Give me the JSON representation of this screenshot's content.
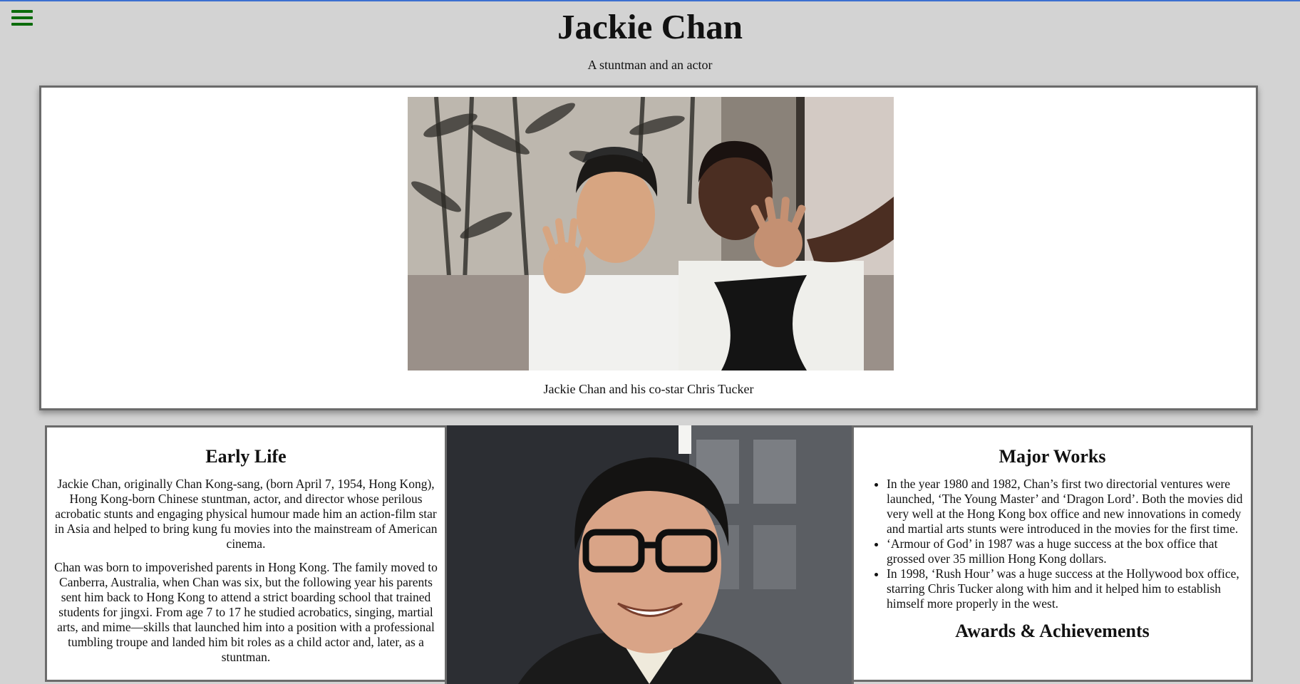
{
  "header": {
    "title": "Jackie Chan",
    "subtitle": "A stuntman and an actor",
    "menu_icon": "hamburger-menu-icon"
  },
  "hero": {
    "caption": "Jackie Chan and his co-star Chris Tucker"
  },
  "early_life": {
    "heading": "Early Life",
    "paragraphs": [
      "Jackie Chan, originally Chan Kong-sang, (born April 7, 1954, Hong Kong), Hong Kong-born Chinese stuntman, actor, and director whose perilous acrobatic stunts and engaging physical humour made him an action-film star in Asia and helped to bring kung fu movies into the mainstream of American cinema.",
      "Chan was born to impoverished parents in Hong Kong. The family moved to Canberra, Australia, when Chan was six, but the following year his parents sent him back to Hong Kong to attend a strict boarding school that trained students for jingxi. From age 7 to 17 he studied acrobatics, singing, martial arts, and mime—skills that launched him into a position with a professional tumbling troupe and landed him bit roles as a child actor and, later, as a stuntman."
    ]
  },
  "major_works": {
    "heading": "Major Works",
    "items": [
      "In the year 1980 and 1982, Chan’s first two directorial ventures were launched, ‘The Young Master’ and ‘Dragon Lord’. Both the movies did very well at the Hong Kong box office and new innovations in comedy and martial arts stunts were introduced in the movies for the first time.",
      "‘Armour of God’ in 1987 was a huge success at the box office that grossed over 35 million Hong Kong dollars.",
      "In 1998, ‘Rush Hour’ was a huge success at the Hollywood box office, starring Chris Tucker along with him and it helped him to establish himself more properly in the west."
    ]
  },
  "awards": {
    "heading": "Awards & Achievements"
  },
  "colors": {
    "background": "#d3d3d3",
    "menu_icon": "#0b6b0b",
    "card_border": "#6b6b6b",
    "top_line": "#3b6fd0"
  }
}
